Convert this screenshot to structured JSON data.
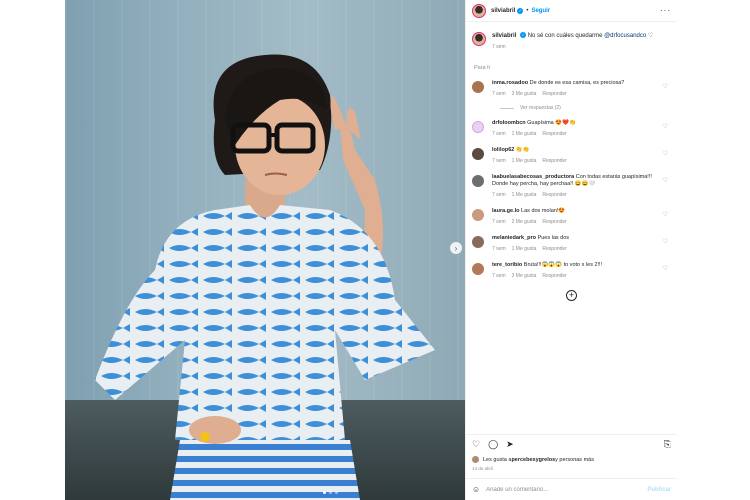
{
  "post": {
    "username": "silviabril",
    "follow_label": "Seguir",
    "separator": "•",
    "more": "···"
  },
  "caption": {
    "username": "silviabril",
    "text": "No sé con cuáles quedarme ",
    "mention": "@drfocusandco",
    "heart": "♡",
    "time": "7 sem"
  },
  "section_label": "Para ti",
  "comments": [
    {
      "user": "inma.rosadoo",
      "text": "De donde es esa camisa, es preciosa?",
      "time": "7 sem",
      "likes": "3 Me gusta",
      "reply": "Responder",
      "avatar_color": "#a8734f"
    },
    {
      "user": "drfoloombcn",
      "text": "Guapísima 😍❤️👏",
      "time": "7 sem",
      "likes": "1 Me gusta",
      "reply": "Responder",
      "avatar_color": "#e9d2f0"
    },
    {
      "user": "lolilop62",
      "text": "👏👏",
      "time": "7 sem",
      "likes": "1 Me gusta",
      "reply": "Responder",
      "avatar_color": "#5b4a40"
    },
    {
      "user": "laabuelasabecosas_productora",
      "text": "Con todas estarás guapísima!!! Donde hay percha, hay perchaa!! 😄😄🤍",
      "time": "7 sem",
      "likes": "1 Me gusta",
      "reply": "Responder",
      "avatar_color": "#6d6d6d"
    },
    {
      "user": "laura.ge.lo",
      "text": "Las dos molan!😍",
      "time": "7 sem",
      "likes": "2 Me gusta",
      "reply": "Responder",
      "avatar_color": "#c99a7b"
    },
    {
      "user": "melaniedark_pro",
      "text": "Pues las dos",
      "time": "7 sem",
      "likes": "1 Me gusta",
      "reply": "Responder",
      "avatar_color": "#8a6a5a"
    },
    {
      "user": "tere_toribio",
      "text": "Bruta!!!😱😱😱 to voto x les 2!!!",
      "time": "7 sem",
      "likes": "3 Me gusta",
      "reply": "Responder",
      "avatar_color": "#b27a58"
    }
  ],
  "replies_label": "Ver respuestas (2)",
  "footer": {
    "likes_text": "Les gusta a ",
    "likes_user": "percebesygrelos",
    "likes_rest": " y personas más",
    "date": "14 de abril",
    "comment_placeholder": "Añade un comentario...",
    "publish_label": "Publicar"
  },
  "icons": {
    "heart": "♡",
    "comment": "◯",
    "share": "➤",
    "save": "⎘",
    "emoji": "☺",
    "plus": "+",
    "next": "›"
  },
  "colors": {
    "accent": "#0095f6",
    "mention": "#00376b",
    "muted": "#8e8e8e"
  },
  "carousel": {
    "slide_count": 3,
    "active_slide": 1
  }
}
